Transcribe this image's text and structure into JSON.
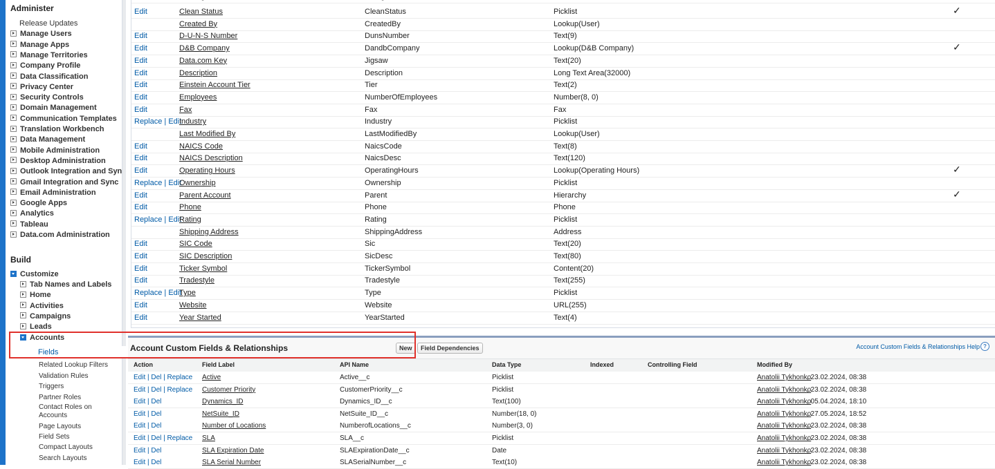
{
  "sidebar": {
    "administer_heading": "Administer",
    "administer_items": [
      {
        "label": "Release Updates",
        "expandable": false
      },
      {
        "label": "Manage Users",
        "expandable": true
      },
      {
        "label": "Manage Apps",
        "expandable": true
      },
      {
        "label": "Manage Territories",
        "expandable": true
      },
      {
        "label": "Company Profile",
        "expandable": true
      },
      {
        "label": "Data Classification",
        "expandable": true
      },
      {
        "label": "Privacy Center",
        "expandable": true
      },
      {
        "label": "Security Controls",
        "expandable": true
      },
      {
        "label": "Domain Management",
        "expandable": true
      },
      {
        "label": "Communication Templates",
        "expandable": true
      },
      {
        "label": "Translation Workbench",
        "expandable": true
      },
      {
        "label": "Data Management",
        "expandable": true
      },
      {
        "label": "Mobile Administration",
        "expandable": true
      },
      {
        "label": "Desktop Administration",
        "expandable": true
      },
      {
        "label": "Outlook Integration and Sync",
        "expandable": true
      },
      {
        "label": "Gmail Integration and Sync",
        "expandable": true
      },
      {
        "label": "Email Administration",
        "expandable": true
      },
      {
        "label": "Google Apps",
        "expandable": true
      },
      {
        "label": "Analytics",
        "expandable": true
      },
      {
        "label": "Tableau",
        "expandable": true
      },
      {
        "label": "Data.com Administration",
        "expandable": true
      }
    ],
    "build_heading": "Build",
    "customize_label": "Customize",
    "customize_items": [
      "Tab Names and Labels",
      "Home",
      "Activities",
      "Campaigns",
      "Leads"
    ],
    "accounts_label": "Accounts",
    "accounts_items": [
      "Fields",
      "Related Lookup Filters",
      "Validation Rules",
      "Triggers",
      "Partner Roles",
      "Contact Roles on Accounts",
      "Page Layouts",
      "Field Sets",
      "Compact Layouts",
      "Search Layouts"
    ]
  },
  "standard_fields": {
    "rows": [
      {
        "action": "Edit",
        "label": "Clean Status",
        "name": "CleanStatus",
        "type": "Picklist",
        "controlling": true
      },
      {
        "action": "",
        "label": "Created By",
        "name": "CreatedBy",
        "type": "Lookup(User)",
        "controlling": false
      },
      {
        "action": "Edit",
        "label": "D-U-N-S Number",
        "name": "DunsNumber",
        "type": "Text(9)",
        "controlling": false
      },
      {
        "action": "Edit",
        "label": "D&B Company",
        "name": "DandbCompany",
        "type": "Lookup(D&B Company)",
        "controlling": true
      },
      {
        "action": "Edit",
        "label": "Data.com Key",
        "name": "Jigsaw",
        "type": "Text(20)",
        "controlling": false
      },
      {
        "action": "Edit",
        "label": "Description",
        "name": "Description",
        "type": "Long Text Area(32000)",
        "controlling": false
      },
      {
        "action": "Edit",
        "label": "Einstein Account Tier",
        "name": "Tier",
        "type": "Text(2)",
        "controlling": false
      },
      {
        "action": "Edit",
        "label": "Employees",
        "name": "NumberOfEmployees",
        "type": "Number(8, 0)",
        "controlling": false
      },
      {
        "action": "Edit",
        "label": "Fax",
        "name": "Fax",
        "type": "Fax",
        "controlling": false
      },
      {
        "action": "Replace | Edit",
        "label": "Industry",
        "name": "Industry",
        "type": "Picklist",
        "controlling": false
      },
      {
        "action": "",
        "label": "Last Modified By",
        "name": "LastModifiedBy",
        "type": "Lookup(User)",
        "controlling": false
      },
      {
        "action": "Edit",
        "label": "NAICS Code",
        "name": "NaicsCode",
        "type": "Text(8)",
        "controlling": false
      },
      {
        "action": "Edit",
        "label": "NAICS Description",
        "name": "NaicsDesc",
        "type": "Text(120)",
        "controlling": false
      },
      {
        "action": "Edit",
        "label": "Operating Hours",
        "name": "OperatingHours",
        "type": "Lookup(Operating Hours)",
        "controlling": true
      },
      {
        "action": "Replace | Edit",
        "label": "Ownership",
        "name": "Ownership",
        "type": "Picklist",
        "controlling": false
      },
      {
        "action": "Edit",
        "label": "Parent Account",
        "name": "Parent",
        "type": "Hierarchy",
        "controlling": true
      },
      {
        "action": "Edit",
        "label": "Phone",
        "name": "Phone",
        "type": "Phone",
        "controlling": false
      },
      {
        "action": "Replace | Edit",
        "label": "Rating",
        "name": "Rating",
        "type": "Picklist",
        "controlling": false
      },
      {
        "action": "",
        "label": "Shipping Address",
        "name": "ShippingAddress",
        "type": "Address",
        "controlling": false
      },
      {
        "action": "Edit",
        "label": "SIC Code",
        "name": "Sic",
        "type": "Text(20)",
        "controlling": false
      },
      {
        "action": "Edit",
        "label": "SIC Description",
        "name": "SicDesc",
        "type": "Text(80)",
        "controlling": false
      },
      {
        "action": "Edit",
        "label": "Ticker Symbol",
        "name": "TickerSymbol",
        "type": "Content(20)",
        "controlling": false
      },
      {
        "action": "Edit",
        "label": "Tradestyle",
        "name": "Tradestyle",
        "type": "Text(255)",
        "controlling": false
      },
      {
        "action": "Replace | Edit",
        "label": "Type",
        "name": "Type",
        "type": "Picklist",
        "controlling": false
      },
      {
        "action": "Edit",
        "label": "Website",
        "name": "Website",
        "type": "URL(255)",
        "controlling": false
      },
      {
        "action": "Edit",
        "label": "Year Started",
        "name": "YearStarted",
        "type": "Text(4)",
        "controlling": false
      }
    ]
  },
  "custom_fields": {
    "title": "Account Custom Fields & Relationships",
    "new_button": "New",
    "dependencies_button": "Field Dependencies",
    "help_link": "Account Custom Fields & Relationships Help",
    "headers": [
      "Action",
      "Field Label",
      "API Name",
      "Data Type",
      "Indexed",
      "Controlling Field",
      "Modified By"
    ],
    "rows": [
      {
        "action": "Edit | Del | Replace",
        "label": "Active",
        "api": "Active__c",
        "type": "Picklist",
        "user": "Anatolii Tykhonko",
        "date": ", 23.02.2024, 08:38"
      },
      {
        "action": "Edit | Del | Replace",
        "label": "Customer Priority",
        "api": "CustomerPriority__c",
        "type": "Picklist",
        "user": "Anatolii Tykhonko",
        "date": ", 23.02.2024, 08:38"
      },
      {
        "action": "Edit | Del",
        "label": "Dynamics_ID",
        "api": "Dynamics_ID__c",
        "type": "Text(100)",
        "user": "Anatolii Tykhonko",
        "date": ", 05.04.2024, 18:10"
      },
      {
        "action": "Edit | Del",
        "label": "NetSuite_ID",
        "api": "NetSuite_ID__c",
        "type": "Number(18, 0)",
        "user": "Anatolii Tykhonko",
        "date": ", 27.05.2024, 18:52"
      },
      {
        "action": "Edit | Del",
        "label": "Number of Locations",
        "api": "NumberofLocations__c",
        "type": "Number(3, 0)",
        "user": "Anatolii Tykhonko",
        "date": ", 23.02.2024, 08:38"
      },
      {
        "action": "Edit | Del | Replace",
        "label": "SLA",
        "api": "SLA__c",
        "type": "Picklist",
        "user": "Anatolii Tykhonko",
        "date": ", 23.02.2024, 08:38"
      },
      {
        "action": "Edit | Del",
        "label": "SLA Expiration Date",
        "api": "SLAExpirationDate__c",
        "type": "Date",
        "user": "Anatolii Tykhonko",
        "date": ", 23.02.2024, 08:38"
      },
      {
        "action": "Edit | Del",
        "label": "SLA Serial Number",
        "api": "SLASerialNumber__c",
        "type": "Text(10)",
        "user": "Anatolii Tykhonko",
        "date": ", 23.02.2024, 08:38"
      }
    ]
  },
  "accent_color": "#1d73c9",
  "highlight_color": "#e0302a"
}
